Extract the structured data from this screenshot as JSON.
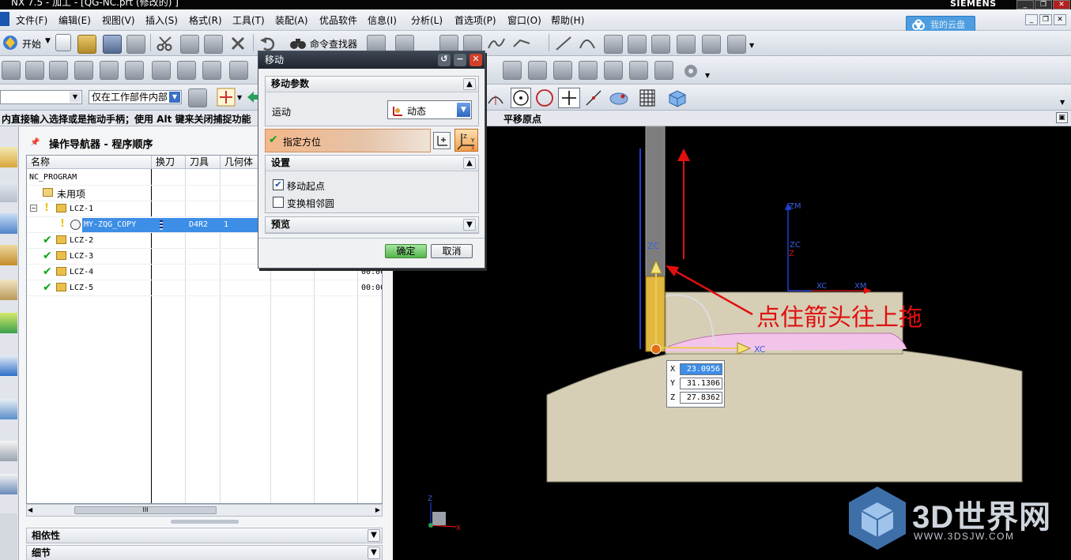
{
  "window": {
    "title": "NX 7.5 - 加工 - [QG-NC.prt (修改的) ]",
    "brand": "SIEMENS",
    "controls": [
      "_",
      "❐",
      "✕"
    ]
  },
  "menubar": {
    "items": [
      "文件(F)",
      "编辑(E)",
      "视图(V)",
      "插入(S)",
      "格式(R)",
      "工具(T)",
      "装配(A)",
      "优品软件",
      "信息(I)",
      "分析(L)",
      "首选项(P)",
      "窗口(O)",
      "帮助(H)"
    ],
    "badge_label": "我的云盘"
  },
  "toolbar": {
    "start_label": "开始",
    "command_finder_label": "命令查找器",
    "filter_scope_label": "仅在工作部件内部"
  },
  "status": {
    "cue": "内直接输入选择或是拖动手柄；使用 Alt 键来关闭捕捉功能",
    "state": "平移原点"
  },
  "navigator": {
    "title": "操作导航器 - 程序顺序",
    "columns": [
      "名称",
      "换刀",
      "刀具",
      "几何体"
    ],
    "rows": [
      {
        "name": "NC_PROGRAM",
        "tool": "",
        "geom": "",
        "time": ""
      },
      {
        "name": "未用项",
        "tool": "",
        "geom": "",
        "time": ""
      },
      {
        "name": "LCZ-1",
        "tool": "",
        "geom": "",
        "time": ""
      },
      {
        "name": "MY-ZQG_COPY",
        "tool": "D4R2",
        "geom": "1",
        "time": ""
      },
      {
        "name": "LCZ-2",
        "tool": "",
        "geom": "",
        "time": ""
      },
      {
        "name": "LCZ-3",
        "tool": "",
        "geom": "",
        "time": ""
      },
      {
        "name": "LCZ-4",
        "tool": "",
        "geom": "",
        "time": "00:00"
      },
      {
        "name": "LCZ-5",
        "tool": "",
        "geom": "",
        "time": "00:00"
      }
    ],
    "scroll_thumb": "III",
    "sections": [
      "相依性",
      "细节"
    ]
  },
  "dialog": {
    "title": "移动",
    "group_motion": "移动参数",
    "motion_label": "运动",
    "motion_value": "动态",
    "specify_orient": "指定方位",
    "group_settings": "设置",
    "opt_move_start": "移动起点",
    "opt_transform_adjacent": "变换相邻圆",
    "group_preview": "预览",
    "ok_label": "确定",
    "cancel_label": "取消"
  },
  "viewport": {
    "annotation": "点住箭头往上拖",
    "axis_labels": [
      "ZC",
      "XC",
      "ZM",
      "ZC",
      "Z",
      "XC",
      "XM",
      "Z",
      "X"
    ],
    "coords": {
      "x_label": "X",
      "y_label": "Y",
      "z_label": "Z",
      "x": "23.0956",
      "y": "31.1306",
      "z": "27.8362"
    }
  },
  "watermark": {
    "name": "3D世界网",
    "url": "WWW.3DSJW.COM"
  },
  "colors": {
    "accent_selection": "#3d8ee6",
    "annotation_red": "#e01010",
    "part_beige": "#d6cfb6",
    "highlight_orange": "#f0a050"
  }
}
